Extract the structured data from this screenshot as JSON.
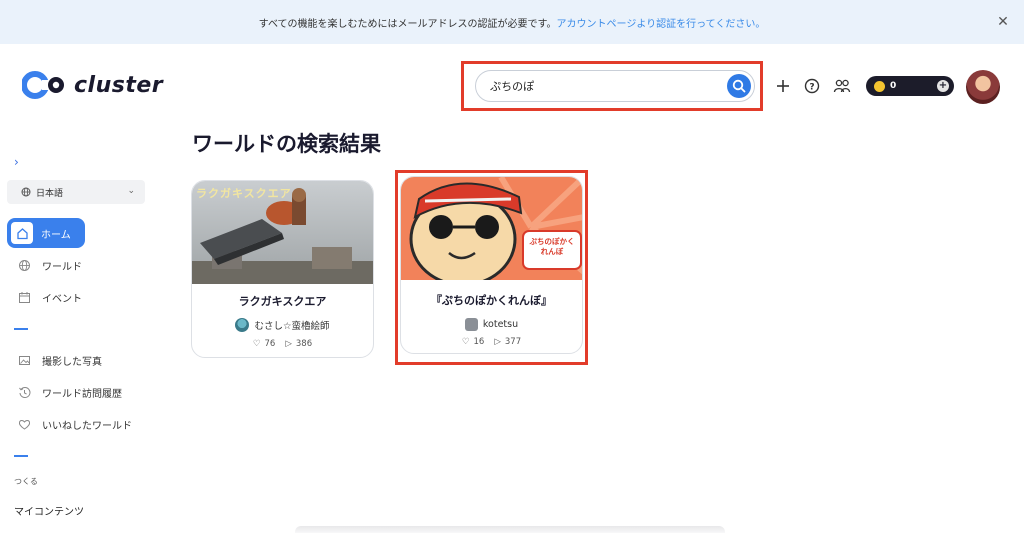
{
  "banner": {
    "text": "すべての機能を楽しむためにはメールアドレスの認証が必要です。",
    "link": "アカウントページより認証を行ってください。"
  },
  "header": {
    "logo_text": "cluster",
    "search_value": "ぷちのぽ",
    "coin_balance": "0",
    "icons": [
      "plus-icon",
      "help-icon",
      "friends-icon",
      "search-icon"
    ]
  },
  "sidebar": {
    "expand_glyph": "›",
    "language": "日本語",
    "items_top": [
      {
        "label": "ホーム",
        "icon": "home-icon",
        "active": true
      },
      {
        "label": "ワールド",
        "icon": "globe-icon"
      },
      {
        "label": "イベント",
        "icon": "calendar-icon"
      }
    ],
    "items_mid": [
      {
        "label": "撮影した写真",
        "icon": "photo-icon"
      },
      {
        "label": "ワールド訪問履歴",
        "icon": "history-icon"
      },
      {
        "label": "いいねしたワールド",
        "icon": "heart-icon"
      }
    ],
    "section_label": "つくる",
    "my_content": "マイコンテンツ"
  },
  "main": {
    "title": "ワールドの検索結果",
    "cards": [
      {
        "title": "ラクガキスクエア",
        "thumb_text": "ラクガキスクエア",
        "author": "むさし☆蛮櫓絵師",
        "likes": "76",
        "plays": "386"
      },
      {
        "title": "『ぷちのぽかくれんぼ』",
        "thumb_text": "ぷちのぽかくれんぼ",
        "author": "kotetsu",
        "likes": "16",
        "plays": "377"
      }
    ]
  },
  "colors": {
    "accent": "#3a80ec",
    "highlight": "#e23c2a",
    "banner_bg": "#eaf2fb"
  }
}
